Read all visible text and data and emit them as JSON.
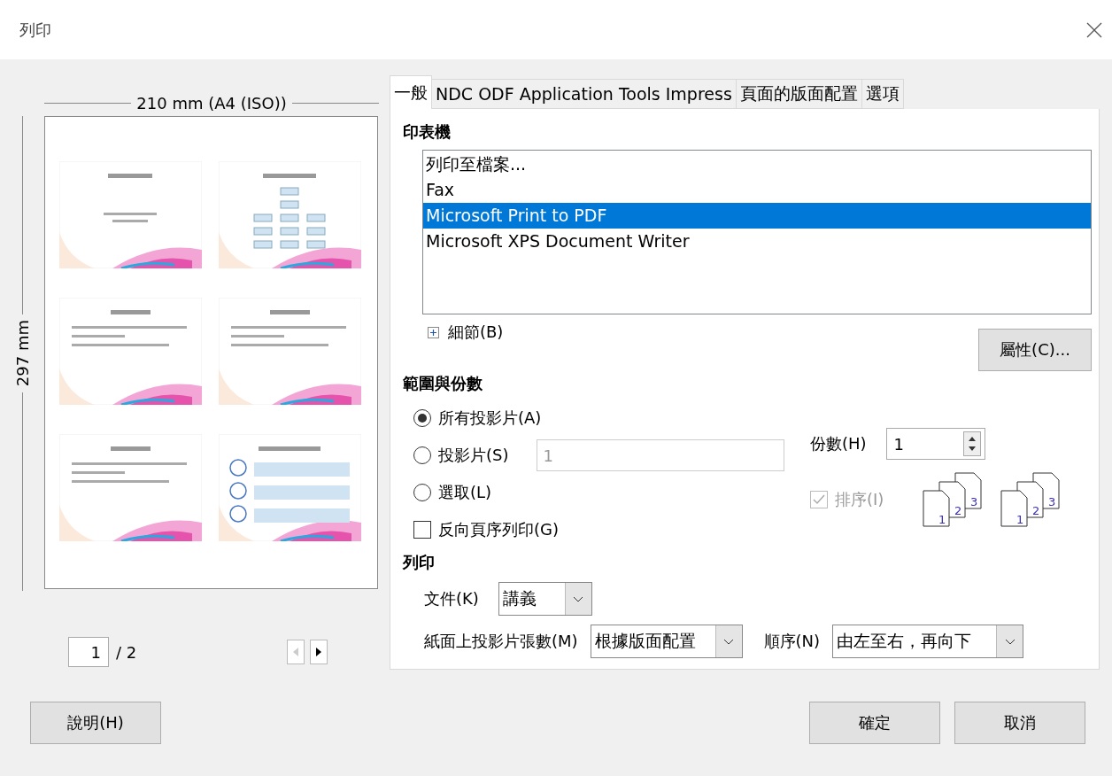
{
  "window": {
    "title": "列印"
  },
  "preview": {
    "width_label": "210 mm (A4 (ISO))",
    "height_label": "297 mm",
    "slides": [
      {
        "kind": "title"
      },
      {
        "kind": "chart"
      },
      {
        "kind": "bullets"
      },
      {
        "kind": "bullets"
      },
      {
        "kind": "bullets"
      },
      {
        "kind": "diagram"
      }
    ],
    "page": "1",
    "page_total": "/ 2",
    "prev_disabled": true
  },
  "tabs": [
    {
      "label": "一般",
      "selected": true
    },
    {
      "label": "NDC ODF Application Tools Impress",
      "selected": false
    },
    {
      "label": "頁面的版面配置",
      "selected": false
    },
    {
      "label": "選項",
      "selected": false
    }
  ],
  "printer": {
    "heading": "印表機",
    "devices": [
      {
        "name": "列印至檔案...",
        "selected": false
      },
      {
        "name": "Fax",
        "selected": false
      },
      {
        "name": "Microsoft Print to PDF",
        "selected": true
      },
      {
        "name": "Microsoft XPS Document Writer",
        "selected": false
      }
    ],
    "details": "細節(B)",
    "details_expanded": false,
    "properties": "屬性(C)..."
  },
  "range": {
    "heading": "範圍與份數",
    "options": [
      {
        "label": "所有投影片(A)",
        "selected": true
      },
      {
        "label": "投影片(S)",
        "selected": false,
        "field": "1"
      },
      {
        "label": "選取(L)",
        "selected": false
      }
    ],
    "reverse": {
      "label": "反向頁序列印(G)",
      "checked": false
    },
    "copies_label": "份數(H)",
    "copies": "1",
    "collate": {
      "label": "排序(I)",
      "checked": true,
      "disabled": true
    },
    "collate_stacks": [
      {
        "pages": [
          "1",
          "2",
          "3"
        ]
      },
      {
        "pages": [
          "1",
          "2",
          "3"
        ]
      }
    ]
  },
  "print": {
    "heading": "列印",
    "document_label": "文件(K)",
    "document": "講義",
    "per_page_label": "紙面上投影片張數(M)",
    "per_page": "根據版面配置",
    "order_label": "順序(N)",
    "order": "由左至右，再向下"
  },
  "buttons": {
    "help": "說明(H)",
    "ok": "確定",
    "cancel": "取消"
  }
}
